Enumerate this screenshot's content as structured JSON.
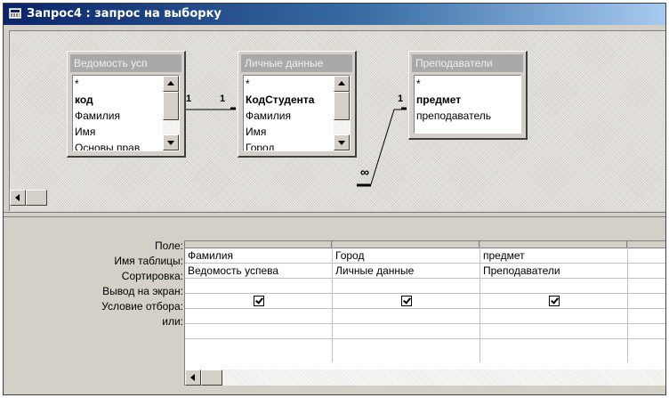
{
  "window": {
    "title": "Запрос4 : запрос на выборку",
    "icon": "query-datasheet-icon"
  },
  "tables": [
    {
      "header": "Ведомость усп",
      "fields": [
        {
          "label": "*",
          "bold": false
        },
        {
          "label": "код",
          "bold": true
        },
        {
          "label": "Фамилия",
          "bold": false
        },
        {
          "label": "Имя",
          "bold": false
        },
        {
          "label": "Основы прав",
          "bold": false
        }
      ]
    },
    {
      "header": "Личные данные",
      "fields": [
        {
          "label": "*",
          "bold": false
        },
        {
          "label": "КодСтудента",
          "bold": true
        },
        {
          "label": "Фамилия",
          "bold": false
        },
        {
          "label": "Имя",
          "bold": false
        },
        {
          "label": "Город",
          "bold": false
        }
      ]
    },
    {
      "header": "Преподаватели",
      "fields": [
        {
          "label": "*",
          "bold": false
        },
        {
          "label": "предмет",
          "bold": true
        },
        {
          "label": "преподаватель",
          "bold": false
        }
      ]
    }
  ],
  "relationships": {
    "rel1_left": "1",
    "rel1_right": "1",
    "rel2_one": "1",
    "rel2_many": "∞"
  },
  "grid": {
    "row_labels": [
      "Поле:",
      "Имя таблицы:",
      "Сортировка:",
      "Вывод на экран:",
      "Условие отбора:",
      "или:"
    ],
    "columns": [
      {
        "field": "Фамилия",
        "table": "Ведомость успева",
        "sort": "",
        "show": true,
        "criteria": "",
        "or": ""
      },
      {
        "field": "Город",
        "table": "Личные данные",
        "sort": "",
        "show": true,
        "criteria": "",
        "or": ""
      },
      {
        "field": "предмет",
        "table": "Преподаватели",
        "sort": "",
        "show": true,
        "criteria": "",
        "or": ""
      },
      {
        "field": "",
        "table": "",
        "sort": "",
        "show": false,
        "criteria": "",
        "or": ""
      }
    ]
  },
  "colors": {
    "title_start": "#0a246a",
    "title_end": "#a6caf0",
    "face": "#d4d0c8",
    "table_header": "#a9a9a9"
  }
}
